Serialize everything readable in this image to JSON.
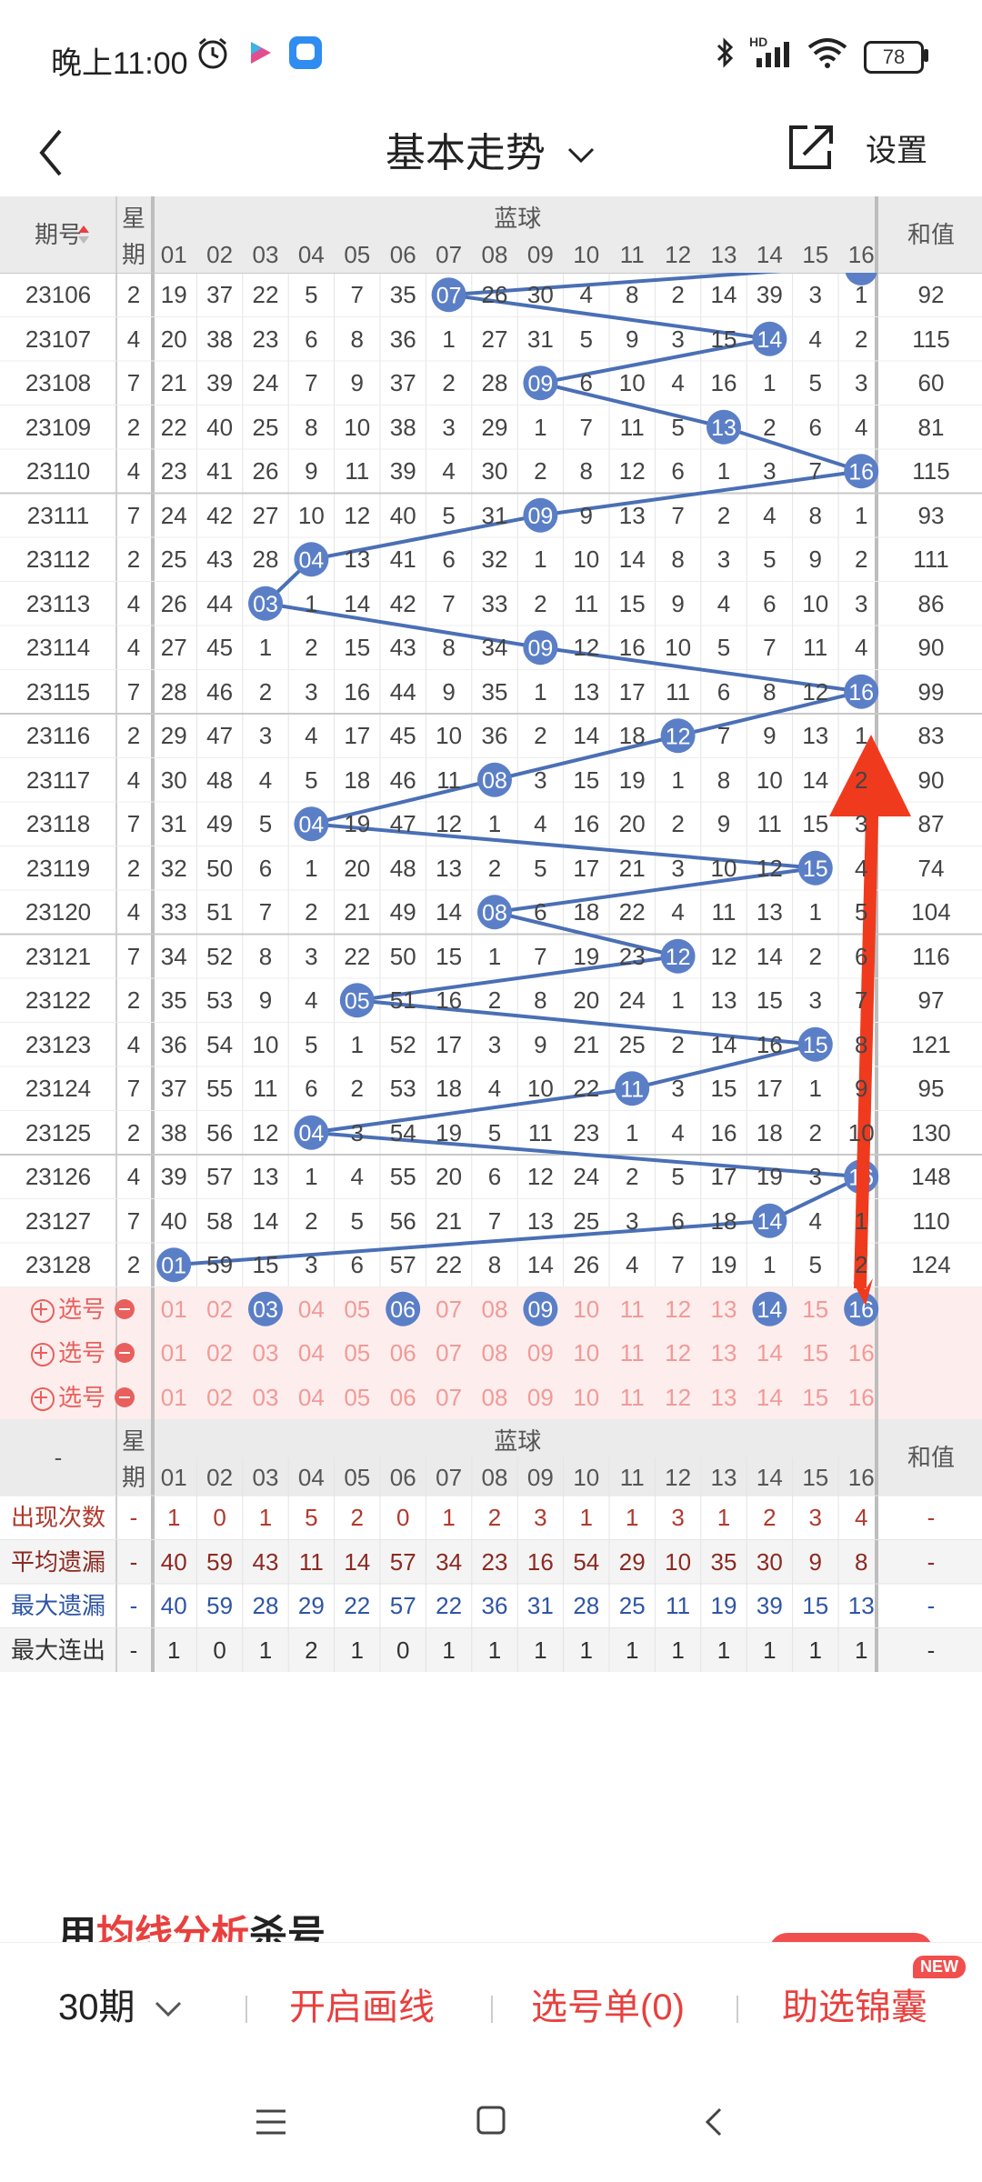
{
  "status": {
    "time": "晚上11:00",
    "battery": "78",
    "hd_label": "HD"
  },
  "header": {
    "title": "基本走势",
    "settings_label": "设置"
  },
  "table": {
    "col_period": "期号",
    "col_week_top": "星",
    "col_week_bottom": "期",
    "col_blue": "蓝球",
    "col_sum": "和值",
    "number_headers": [
      "01",
      "02",
      "03",
      "04",
      "05",
      "06",
      "07",
      "08",
      "09",
      "10",
      "11",
      "12",
      "13",
      "14",
      "15",
      "16"
    ],
    "rows": [
      {
        "period": "23106",
        "week": "2",
        "sum": "92",
        "hit": 7,
        "cells": [
          "19",
          "37",
          "22",
          "5",
          "7",
          "35",
          "07",
          "26",
          "30",
          "4",
          "8",
          "2",
          "14",
          "39",
          "3",
          "1"
        ]
      },
      {
        "period": "23107",
        "week": "4",
        "sum": "115",
        "hit": 14,
        "cells": [
          "20",
          "38",
          "23",
          "6",
          "8",
          "36",
          "1",
          "27",
          "31",
          "5",
          "9",
          "3",
          "15",
          "14",
          "4",
          "2"
        ]
      },
      {
        "period": "23108",
        "week": "7",
        "sum": "60",
        "hit": 9,
        "cells": [
          "21",
          "39",
          "24",
          "7",
          "9",
          "37",
          "2",
          "28",
          "09",
          "6",
          "10",
          "4",
          "16",
          "1",
          "5",
          "3"
        ]
      },
      {
        "period": "23109",
        "week": "2",
        "sum": "81",
        "hit": 13,
        "cells": [
          "22",
          "40",
          "25",
          "8",
          "10",
          "38",
          "3",
          "29",
          "1",
          "7",
          "11",
          "5",
          "13",
          "2",
          "6",
          "4"
        ]
      },
      {
        "period": "23110",
        "week": "4",
        "sum": "115",
        "hit": 16,
        "cells": [
          "23",
          "41",
          "26",
          "9",
          "11",
          "39",
          "4",
          "30",
          "2",
          "8",
          "12",
          "6",
          "1",
          "3",
          "7",
          "16"
        ]
      },
      {
        "period": "23111",
        "week": "7",
        "sum": "93",
        "hit": 9,
        "cells": [
          "24",
          "42",
          "27",
          "10",
          "12",
          "40",
          "5",
          "31",
          "09",
          "9",
          "13",
          "7",
          "2",
          "4",
          "8",
          "1"
        ]
      },
      {
        "period": "23112",
        "week": "2",
        "sum": "111",
        "hit": 4,
        "cells": [
          "25",
          "43",
          "28",
          "04",
          "13",
          "41",
          "6",
          "32",
          "1",
          "10",
          "14",
          "8",
          "3",
          "5",
          "9",
          "2"
        ]
      },
      {
        "period": "23113",
        "week": "4",
        "sum": "86",
        "hit": 3,
        "cells": [
          "26",
          "44",
          "03",
          "1",
          "14",
          "42",
          "7",
          "33",
          "2",
          "11",
          "15",
          "9",
          "4",
          "6",
          "10",
          "3"
        ]
      },
      {
        "period": "23114",
        "week": "4",
        "sum": "90",
        "hit": 9,
        "cells": [
          "27",
          "45",
          "1",
          "2",
          "15",
          "43",
          "8",
          "34",
          "09",
          "12",
          "16",
          "10",
          "5",
          "7",
          "11",
          "4"
        ]
      },
      {
        "period": "23115",
        "week": "7",
        "sum": "99",
        "hit": 16,
        "cells": [
          "28",
          "46",
          "2",
          "3",
          "16",
          "44",
          "9",
          "35",
          "1",
          "13",
          "17",
          "11",
          "6",
          "8",
          "12",
          "16"
        ]
      },
      {
        "period": "23116",
        "week": "2",
        "sum": "83",
        "hit": 12,
        "cells": [
          "29",
          "47",
          "3",
          "4",
          "17",
          "45",
          "10",
          "36",
          "2",
          "14",
          "18",
          "12",
          "7",
          "9",
          "13",
          "1"
        ]
      },
      {
        "period": "23117",
        "week": "4",
        "sum": "90",
        "hit": 8,
        "cells": [
          "30",
          "48",
          "4",
          "5",
          "18",
          "46",
          "11",
          "08",
          "3",
          "15",
          "19",
          "1",
          "8",
          "10",
          "14",
          "2"
        ]
      },
      {
        "period": "23118",
        "week": "7",
        "sum": "87",
        "hit": 4,
        "cells": [
          "31",
          "49",
          "5",
          "04",
          "19",
          "47",
          "12",
          "1",
          "4",
          "16",
          "20",
          "2",
          "9",
          "11",
          "15",
          "3"
        ]
      },
      {
        "period": "23119",
        "week": "2",
        "sum": "74",
        "hit": 15,
        "cells": [
          "32",
          "50",
          "6",
          "1",
          "20",
          "48",
          "13",
          "2",
          "5",
          "17",
          "21",
          "3",
          "10",
          "12",
          "15",
          "4"
        ]
      },
      {
        "period": "23120",
        "week": "4",
        "sum": "104",
        "hit": 8,
        "cells": [
          "33",
          "51",
          "7",
          "2",
          "21",
          "49",
          "14",
          "08",
          "6",
          "18",
          "22",
          "4",
          "11",
          "13",
          "1",
          "5"
        ]
      },
      {
        "period": "23121",
        "week": "7",
        "sum": "116",
        "hit": 12,
        "cells": [
          "34",
          "52",
          "8",
          "3",
          "22",
          "50",
          "15",
          "1",
          "7",
          "19",
          "23",
          "12",
          "12",
          "14",
          "2",
          "6"
        ]
      },
      {
        "period": "23122",
        "week": "2",
        "sum": "97",
        "hit": 5,
        "cells": [
          "35",
          "53",
          "9",
          "4",
          "05",
          "51",
          "16",
          "2",
          "8",
          "20",
          "24",
          "1",
          "13",
          "15",
          "3",
          "7"
        ]
      },
      {
        "period": "23123",
        "week": "4",
        "sum": "121",
        "hit": 15,
        "cells": [
          "36",
          "54",
          "10",
          "5",
          "1",
          "52",
          "17",
          "3",
          "9",
          "21",
          "25",
          "2",
          "14",
          "16",
          "15",
          "8"
        ]
      },
      {
        "period": "23124",
        "week": "7",
        "sum": "95",
        "hit": 11,
        "cells": [
          "37",
          "55",
          "11",
          "6",
          "2",
          "53",
          "18",
          "4",
          "10",
          "22",
          "11",
          "3",
          "15",
          "17",
          "1",
          "9"
        ]
      },
      {
        "period": "23125",
        "week": "2",
        "sum": "130",
        "hit": 4,
        "cells": [
          "38",
          "56",
          "12",
          "04",
          "3",
          "54",
          "19",
          "5",
          "11",
          "23",
          "1",
          "4",
          "16",
          "18",
          "2",
          "10"
        ]
      },
      {
        "period": "23126",
        "week": "4",
        "sum": "148",
        "hit": 16,
        "cells": [
          "39",
          "57",
          "13",
          "1",
          "4",
          "55",
          "20",
          "6",
          "12",
          "24",
          "2",
          "5",
          "17",
          "19",
          "3",
          "16"
        ]
      },
      {
        "period": "23127",
        "week": "7",
        "sum": "110",
        "hit": 14,
        "cells": [
          "40",
          "58",
          "14",
          "2",
          "5",
          "56",
          "21",
          "7",
          "13",
          "25",
          "3",
          "6",
          "18",
          "14",
          "4",
          "1"
        ]
      },
      {
        "period": "23128",
        "week": "2",
        "sum": "124",
        "hit": 1,
        "cells": [
          "01",
          "59",
          "15",
          "3",
          "6",
          "57",
          "22",
          "8",
          "14",
          "26",
          "4",
          "7",
          "19",
          "1",
          "5",
          "2"
        ]
      }
    ],
    "select_label": "选号",
    "select_rows": [
      {
        "selected": [
          3,
          6,
          9,
          14,
          16
        ]
      },
      {
        "selected": []
      },
      {
        "selected": []
      }
    ],
    "stats": [
      {
        "label": "出现次数",
        "week": "-",
        "sum": "-",
        "color": "#b03a2e",
        "values": [
          "1",
          "0",
          "1",
          "5",
          "2",
          "0",
          "1",
          "2",
          "3",
          "1",
          "1",
          "3",
          "1",
          "2",
          "3",
          "4"
        ]
      },
      {
        "label": "平均遗漏",
        "week": "-",
        "sum": "-",
        "color": "#8b2a22",
        "values": [
          "40",
          "59",
          "43",
          "11",
          "14",
          "57",
          "34",
          "23",
          "16",
          "54",
          "29",
          "10",
          "35",
          "30",
          "9",
          "8"
        ]
      },
      {
        "label": "最大遗漏",
        "week": "-",
        "sum": "-",
        "color": "#2f55a4",
        "values": [
          "40",
          "59",
          "28",
          "29",
          "22",
          "57",
          "22",
          "36",
          "31",
          "28",
          "25",
          "11",
          "19",
          "39",
          "15",
          "13"
        ]
      },
      {
        "label": "最大连出",
        "week": "-",
        "sum": "-",
        "color": "#333333",
        "values": [
          "1",
          "0",
          "1",
          "2",
          "1",
          "0",
          "1",
          "1",
          "1",
          "1",
          "1",
          "1",
          "1",
          "1",
          "1",
          "1"
        ]
      }
    ],
    "footer_period_label": "-"
  },
  "promo": {
    "prefix": "用",
    "highlight": "均线分析",
    "suffix": "杀号"
  },
  "bottom_bar": {
    "period": "30期",
    "draw_line": "开启画线",
    "selection_list": "选号单(0)",
    "assist": "助选锦囊",
    "new_badge": "NEW"
  },
  "colors": {
    "accent": "#e8403e",
    "ball": "#5b7fc7",
    "line": "#4a6fb5",
    "arrow": "#f03a1e"
  }
}
